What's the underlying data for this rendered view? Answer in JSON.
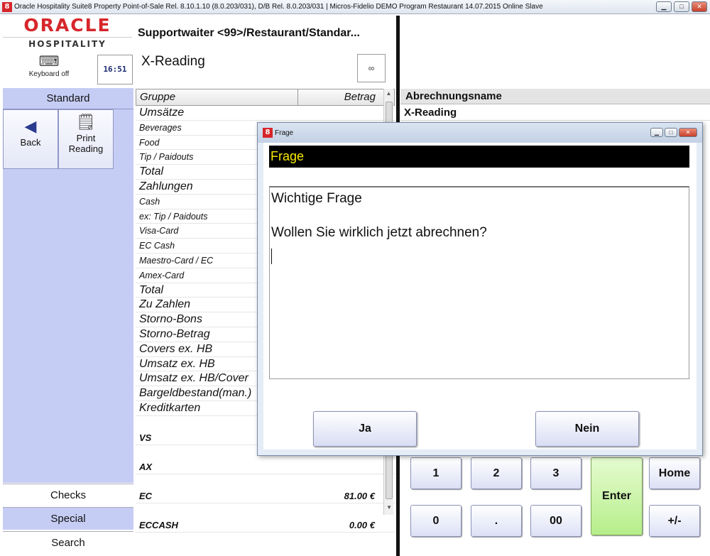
{
  "window": {
    "title": "Oracle Hospitality Suite8 Property Point-of-Sale Rel. 8.10.1.10 (8.0.203/031), D/B Rel. 8.0.203/031 | Micros-Fidelio DEMO Program Restaurant 14.07.2015 Online Slave",
    "app_icon": "8",
    "controls": [
      "▁",
      "□",
      "✕"
    ]
  },
  "logo": {
    "brand": "ORACLE",
    "sub": "HOSPITALITY"
  },
  "keyboard": {
    "label": "Keyboard off",
    "icon": "keyboard-icon"
  },
  "clock": "16:51",
  "left": {
    "section": "Standard",
    "buttons": [
      {
        "label": "Back",
        "icon": "back-arrow-icon"
      },
      {
        "label": "Print Reading",
        "icon": "print-document-icon"
      }
    ],
    "tabs": {
      "checks": "Checks",
      "special": "Special",
      "search": "Search"
    }
  },
  "header": {
    "title": "Supportwaiter <99>/Restaurant/Standar...",
    "subtitle": "X-Reading",
    "small_button_icon": "glasses-icon"
  },
  "table": {
    "col_group": "Gruppe",
    "col_amount": "Betrag",
    "rows": [
      {
        "g": "Umsätze",
        "b": ""
      },
      {
        "g": "Beverages",
        "b": ""
      },
      {
        "g": "Food",
        "b": ""
      },
      {
        "g": "Tip / Paidouts",
        "b": ""
      },
      {
        "g": "Total",
        "b": ""
      },
      {
        "g": "Zahlungen",
        "b": ""
      },
      {
        "g": "Cash",
        "b": ""
      },
      {
        "g": "ex: Tip / Paidouts",
        "b": ""
      },
      {
        "g": "Visa-Card",
        "b": ""
      },
      {
        "g": "EC Cash",
        "b": ""
      },
      {
        "g": "Maestro-Card / EC",
        "b": ""
      },
      {
        "g": "Amex-Card",
        "b": ""
      },
      {
        "g": "Total",
        "b": ""
      },
      {
        "g": "Zu Zahlen",
        "b": ""
      },
      {
        "g": "Storno-Bons",
        "b": ""
      },
      {
        "g": "Storno-Betrag",
        "b": ""
      },
      {
        "g": "Covers ex. HB",
        "b": ""
      },
      {
        "g": "Umsatz ex. HB",
        "b": ""
      },
      {
        "g": "Umsatz ex. HB/Cover",
        "b": ""
      },
      {
        "g": "Bargeldbestand(man.)",
        "b": ""
      },
      {
        "g": "Kreditkarten",
        "b": ""
      },
      {
        "g": "VS",
        "b": ""
      },
      {
        "g": "AX",
        "b": ""
      },
      {
        "g": "EC",
        "b": "81.00 €"
      },
      {
        "g": "ECCASH",
        "b": "0.00 €"
      }
    ]
  },
  "right": {
    "col_header": "Abrechnungsname",
    "value": "X-Reading"
  },
  "keypad": {
    "k1": "1",
    "k2": "2",
    "k3": "3",
    "k0": "0",
    "kdot": ".",
    "k00": "00",
    "enter": "Enter",
    "home": "Home",
    "sign": "+/-"
  },
  "dialog": {
    "window_title": "Frage",
    "banner": "Frage",
    "line1": "Wichtige Frage",
    "line2": "Wollen Sie wirklich jetzt abrechnen?",
    "yes": "Ja",
    "no": "Nein"
  }
}
